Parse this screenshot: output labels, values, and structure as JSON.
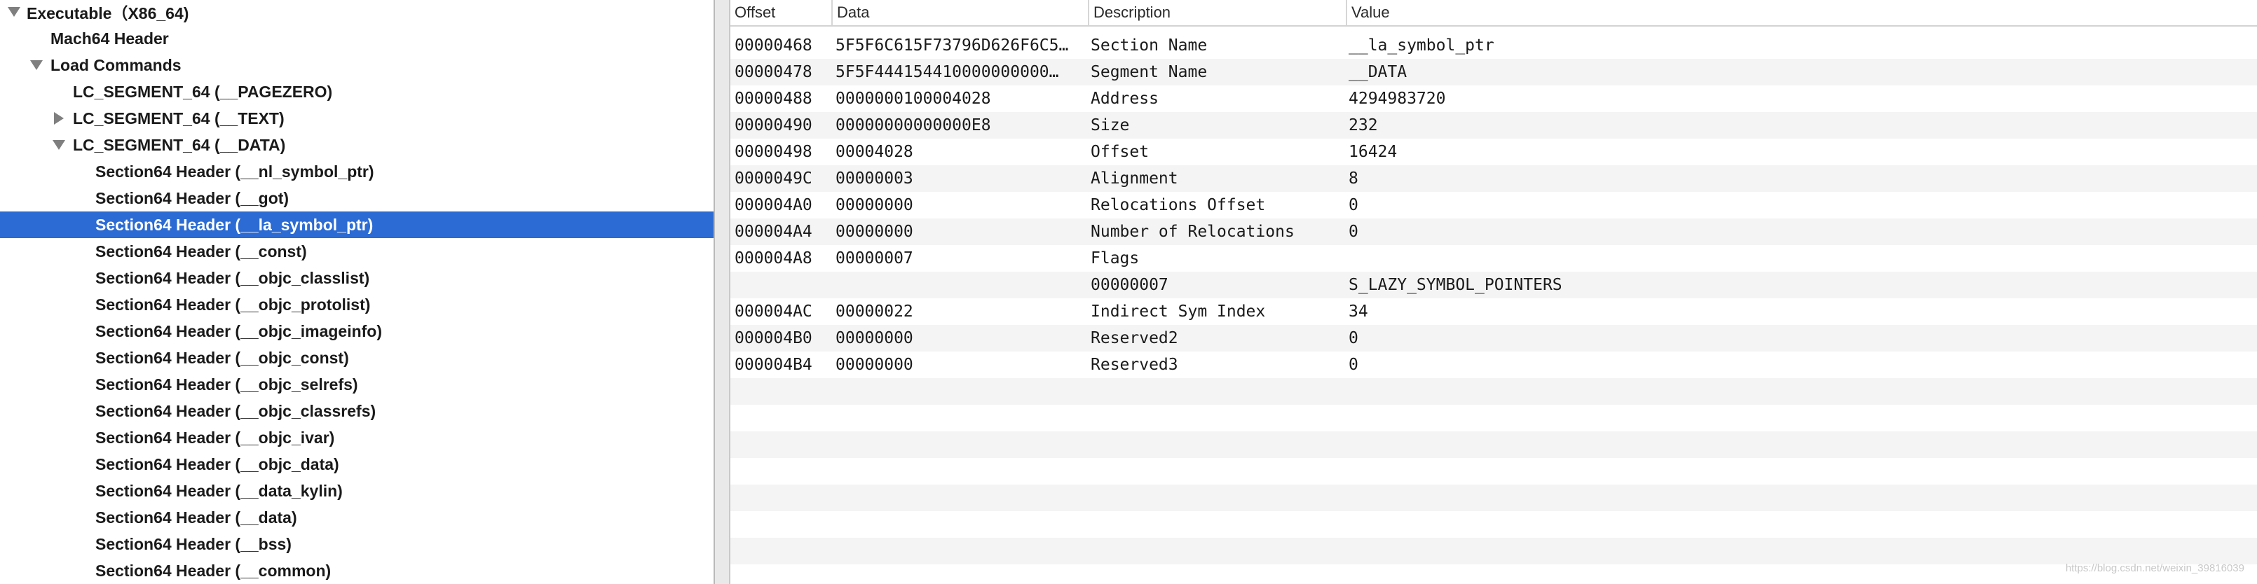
{
  "tree": {
    "items": [
      {
        "label": "Executable（X86_64)",
        "depth": 0,
        "disclosure": "open"
      },
      {
        "label": "Mach64 Header",
        "depth": 1,
        "disclosure": "none"
      },
      {
        "label": "Load Commands",
        "depth": 1,
        "disclosure": "open"
      },
      {
        "label": "LC_SEGMENT_64 (__PAGEZERO)",
        "depth": 2,
        "disclosure": "none"
      },
      {
        "label": "LC_SEGMENT_64 (__TEXT)",
        "depth": 2,
        "disclosure": "closed"
      },
      {
        "label": "LC_SEGMENT_64 (__DATA)",
        "depth": 2,
        "disclosure": "open"
      },
      {
        "label": "Section64 Header (__nl_symbol_ptr)",
        "depth": 3,
        "disclosure": "none"
      },
      {
        "label": "Section64 Header (__got)",
        "depth": 3,
        "disclosure": "none"
      },
      {
        "label": "Section64 Header (__la_symbol_ptr)",
        "depth": 3,
        "disclosure": "none",
        "selected": true
      },
      {
        "label": "Section64 Header (__const)",
        "depth": 3,
        "disclosure": "none"
      },
      {
        "label": "Section64 Header (__objc_classlist)",
        "depth": 3,
        "disclosure": "none"
      },
      {
        "label": "Section64 Header (__objc_protolist)",
        "depth": 3,
        "disclosure": "none"
      },
      {
        "label": "Section64 Header (__objc_imageinfo)",
        "depth": 3,
        "disclosure": "none"
      },
      {
        "label": "Section64 Header (__objc_const)",
        "depth": 3,
        "disclosure": "none"
      },
      {
        "label": "Section64 Header (__objc_selrefs)",
        "depth": 3,
        "disclosure": "none"
      },
      {
        "label": "Section64 Header (__objc_classrefs)",
        "depth": 3,
        "disclosure": "none"
      },
      {
        "label": "Section64 Header (__objc_ivar)",
        "depth": 3,
        "disclosure": "none"
      },
      {
        "label": "Section64 Header (__objc_data)",
        "depth": 3,
        "disclosure": "none"
      },
      {
        "label": "Section64 Header (__data_kylin)",
        "depth": 3,
        "disclosure": "none"
      },
      {
        "label": "Section64 Header (__data)",
        "depth": 3,
        "disclosure": "none"
      },
      {
        "label": "Section64 Header (__bss)",
        "depth": 3,
        "disclosure": "none"
      },
      {
        "label": "Section64 Header (__common)",
        "depth": 3,
        "disclosure": "none"
      }
    ]
  },
  "table": {
    "columns": [
      "Offset",
      "Data",
      "Description",
      "Value"
    ],
    "rows": [
      {
        "offset": "00000468",
        "data": "5F5F6C615F73796D626F6C5…",
        "description": "Section Name",
        "value": "__la_symbol_ptr"
      },
      {
        "offset": "00000478",
        "data": "5F5F444154410000000000…",
        "description": "Segment Name",
        "value": "__DATA"
      },
      {
        "offset": "00000488",
        "data": "0000000100004028",
        "description": "Address",
        "value": "4294983720"
      },
      {
        "offset": "00000490",
        "data": "00000000000000E8",
        "description": "Size",
        "value": "232"
      },
      {
        "offset": "00000498",
        "data": "00004028",
        "description": "Offset",
        "value": "16424"
      },
      {
        "offset": "0000049C",
        "data": "00000003",
        "description": "Alignment",
        "value": "8"
      },
      {
        "offset": "000004A0",
        "data": "00000000",
        "description": "Relocations Offset",
        "value": "0"
      },
      {
        "offset": "000004A4",
        "data": "00000000",
        "description": "Number of Relocations",
        "value": "0"
      },
      {
        "offset": "000004A8",
        "data": "00000007",
        "description": "Flags",
        "value": ""
      },
      {
        "offset": "",
        "data": "",
        "description": "00000007",
        "value": "S_LAZY_SYMBOL_POINTERS"
      },
      {
        "offset": "000004AC",
        "data": "00000022",
        "description": "Indirect Sym Index",
        "value": "34"
      },
      {
        "offset": "000004B0",
        "data": "00000000",
        "description": "Reserved2",
        "value": "0"
      },
      {
        "offset": "000004B4",
        "data": "00000000",
        "description": "Reserved3",
        "value": "0"
      }
    ]
  },
  "watermark": "https://blog.csdn.net/weixin_39816039",
  "colors": {
    "selection": "#2b6bd3",
    "alt_row": "#f4f4f4",
    "disclosure": "#7f7f7f"
  }
}
